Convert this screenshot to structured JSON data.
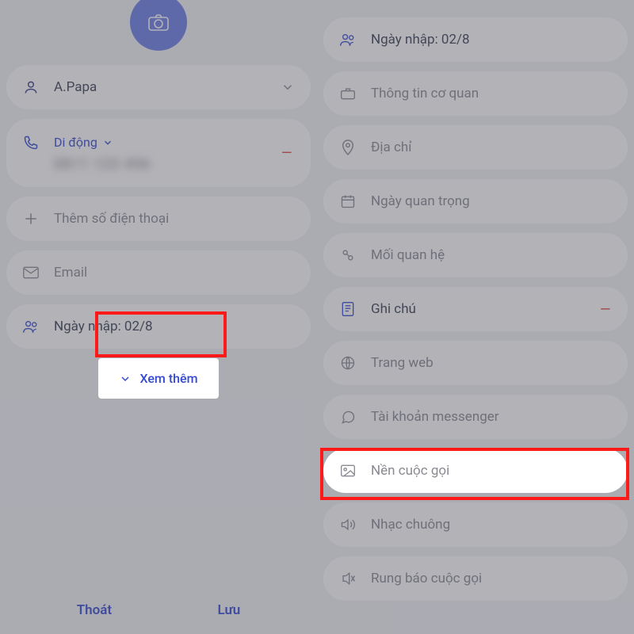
{
  "left": {
    "contact_name": "A.Papa",
    "phone": {
      "type_label": "Di động",
      "number_masked": "0811 123 456"
    },
    "add_phone": "Thêm số điện thoại",
    "email": "Email",
    "group_joined": "Ngày nhập: 02/8",
    "see_more": "Xem thêm",
    "actions": {
      "cancel": "Thoát",
      "save": "Lưu"
    }
  },
  "right": {
    "group_joined": "Ngày nhập: 02/8",
    "org_info": "Thông tin cơ quan",
    "address": "Địa chỉ",
    "important_date": "Ngày quan trọng",
    "relationship": "Mối quan hệ",
    "note": "Ghi chú",
    "website": "Trang web",
    "messenger": "Tài khoản messenger",
    "call_background": "Nền cuộc gọi",
    "ringtone": "Nhạc chuông",
    "call_vibration": "Rung báo cuộc gọi"
  },
  "colors": {
    "accent": "#354ad0",
    "danger": "#d8473f"
  }
}
